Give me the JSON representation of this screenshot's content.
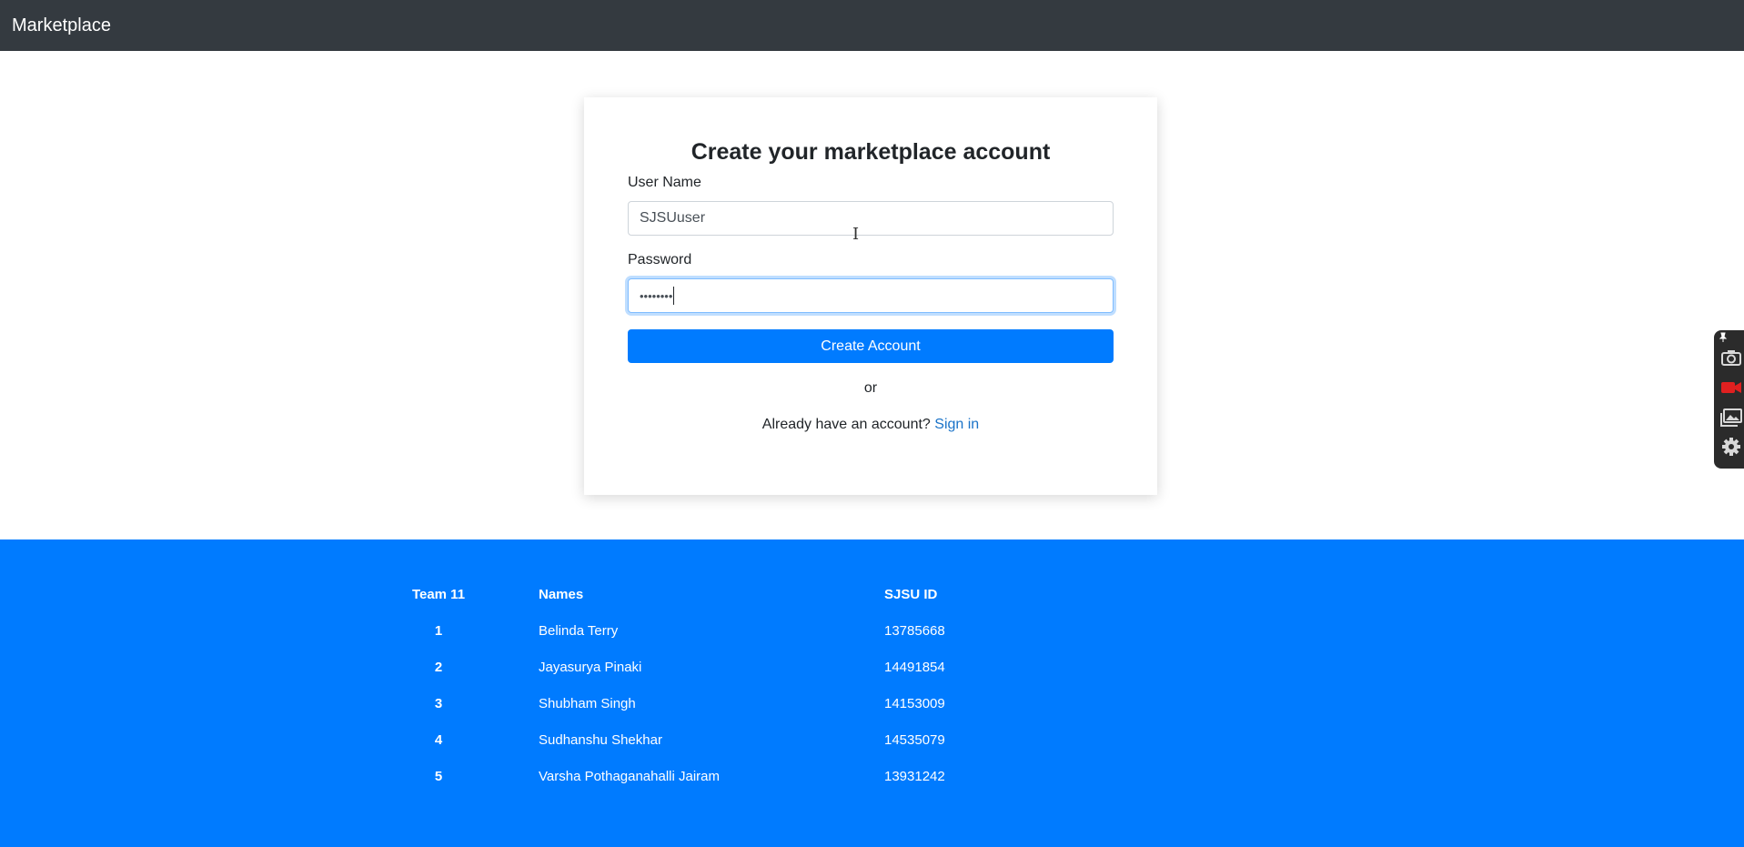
{
  "navbar": {
    "brand": "Marketplace"
  },
  "form": {
    "title": "Create your marketplace account",
    "username_label": "User Name",
    "username_value": "SJSUuser",
    "password_label": "Password",
    "password_value": "••••••••",
    "submit_label": "Create Account",
    "or_text": "or",
    "signin_prompt": "Already have an account?",
    "signin_link": "Sign in"
  },
  "team_table": {
    "headers": [
      "Team 11",
      "Names",
      "SJSU ID"
    ],
    "rows": [
      {
        "num": "1",
        "name": "Belinda Terry",
        "id": "13785668"
      },
      {
        "num": "2",
        "name": "Jayasurya Pinaki",
        "id": "14491854"
      },
      {
        "num": "3",
        "name": "Shubham Singh",
        "id": "14153009"
      },
      {
        "num": "4",
        "name": "Sudhanshu Shekhar",
        "id": "14535079"
      },
      {
        "num": "5",
        "name": "Varsha Pothaganahalli Jairam",
        "id": "13931242"
      }
    ]
  },
  "capture_widget": {
    "icons": [
      "pin-icon",
      "camera-icon",
      "video-record-icon",
      "gallery-icon",
      "settings-gear-icon"
    ],
    "colors": {
      "background": "#2b2b2b",
      "record": "#e02020",
      "icon": "#d8d8d8"
    }
  },
  "colors": {
    "navbar_bg": "#343a40",
    "primary": "#007bff",
    "link": "#1a73c8",
    "text": "#212529"
  }
}
